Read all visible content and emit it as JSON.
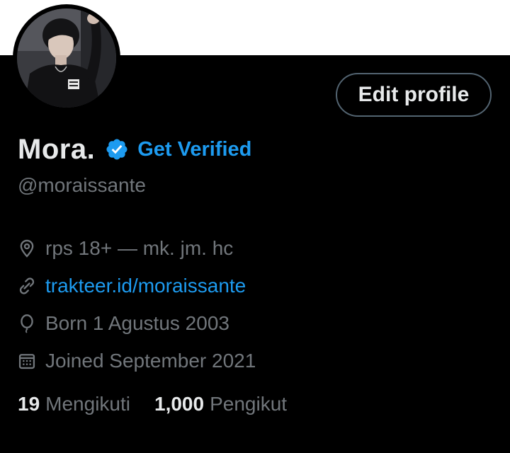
{
  "profile": {
    "display_name": "Mora.",
    "verified_cta": "Get Verified",
    "handle": "@moraissante",
    "edit_button": "Edit profile",
    "avatar_icon": "profile-photo",
    "verified_icon": "verified-badge-icon",
    "meta": {
      "location": "rps 18+ — mk. jm. hc",
      "website": "trakteer.id/moraissante",
      "birthday": "Born 1 Agustus 2003",
      "joined": "Joined September 2021"
    },
    "stats": {
      "following_count": "19",
      "following_label": "Mengikuti",
      "followers_count": "1,000",
      "followers_label": "Pengikut"
    }
  },
  "colors": {
    "background": "#000000",
    "banner": "#ffffff",
    "primary_text": "#e7e9ea",
    "secondary_text": "#71767b",
    "accent": "#1d9bf0",
    "button_border": "#536471"
  }
}
